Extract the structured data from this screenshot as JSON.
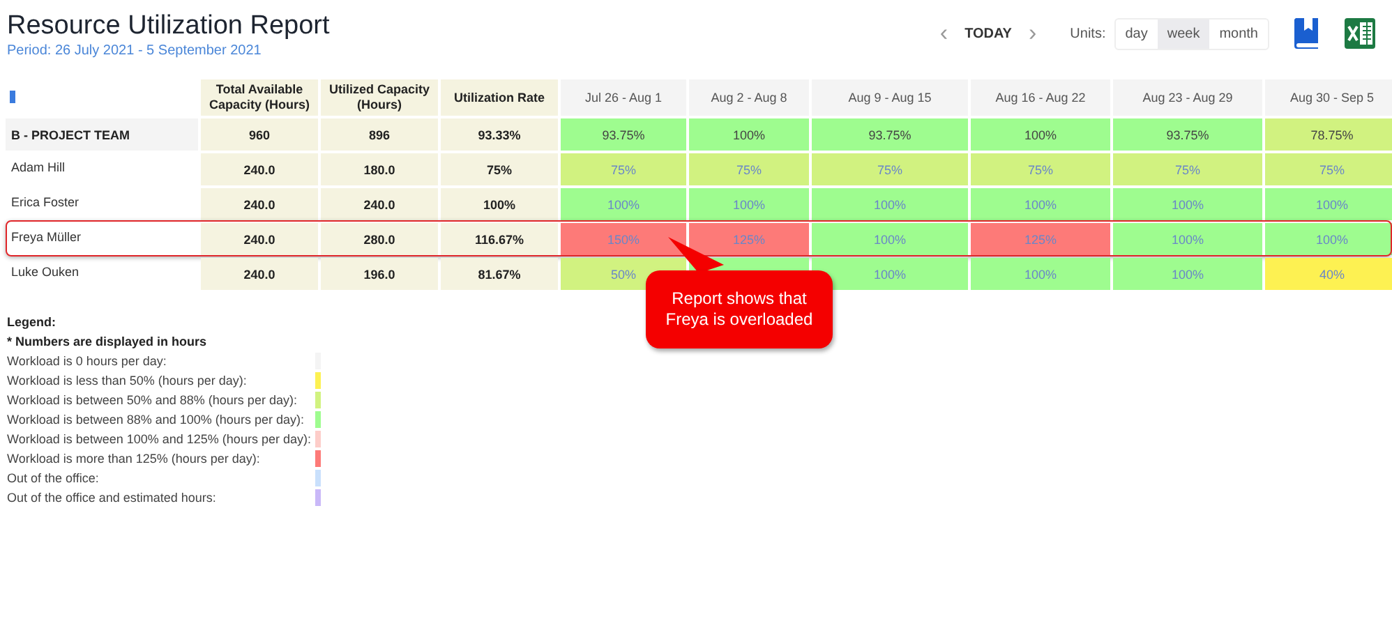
{
  "header": {
    "title": "Resource Utilization Report",
    "period": "Period: 26 July 2021 - 5 September 2021"
  },
  "navigation": {
    "prev": "‹",
    "today": "TODAY",
    "next": "›",
    "units_label": "Units:",
    "units": [
      {
        "label": "day",
        "selected": false
      },
      {
        "label": "week",
        "selected": true
      },
      {
        "label": "month",
        "selected": false
      }
    ]
  },
  "table": {
    "columns": [
      "Total Available Capacity (Hours)",
      "Utilized Capacity (Hours)",
      "Utilization Rate"
    ],
    "weeks": [
      "Jul 26 - Aug 1",
      "Aug 2 - Aug 8",
      "Aug 9 - Aug 15",
      "Aug 16 - Aug 22",
      "Aug 23 - Aug 29",
      "Aug 30 - Sep 5"
    ],
    "rows": [
      {
        "kind": "group",
        "name": "B - PROJECT TEAM",
        "total": "960",
        "utilized": "896",
        "rate": "93.33%",
        "highlighted": false,
        "cells": [
          {
            "text": "93.75%",
            "color": "#9efc8f"
          },
          {
            "text": "100%",
            "color": "#9efc8f"
          },
          {
            "text": "93.75%",
            "color": "#9efc8f"
          },
          {
            "text": "100%",
            "color": "#9efc8f"
          },
          {
            "text": "93.75%",
            "color": "#9efc8f"
          },
          {
            "text": "78.75%",
            "color": "#d1f280"
          }
        ]
      },
      {
        "kind": "person",
        "name": "Adam Hill",
        "total": "240.0",
        "utilized": "180.0",
        "rate": "75%",
        "highlighted": false,
        "cells": [
          {
            "text": "75%",
            "color": "#d1f280"
          },
          {
            "text": "75%",
            "color": "#d1f280"
          },
          {
            "text": "75%",
            "color": "#d1f280"
          },
          {
            "text": "75%",
            "color": "#d1f280"
          },
          {
            "text": "75%",
            "color": "#d1f280"
          },
          {
            "text": "75%",
            "color": "#d1f280"
          }
        ]
      },
      {
        "kind": "person",
        "name": "Erica Foster",
        "total": "240.0",
        "utilized": "240.0",
        "rate": "100%",
        "highlighted": false,
        "cells": [
          {
            "text": "100%",
            "color": "#9efc8f"
          },
          {
            "text": "100%",
            "color": "#9efc8f"
          },
          {
            "text": "100%",
            "color": "#9efc8f"
          },
          {
            "text": "100%",
            "color": "#9efc8f"
          },
          {
            "text": "100%",
            "color": "#9efc8f"
          },
          {
            "text": "100%",
            "color": "#9efc8f"
          }
        ]
      },
      {
        "kind": "person",
        "name": "Freya Müller",
        "total": "240.0",
        "utilized": "280.0",
        "rate": "116.67%",
        "highlighted": true,
        "cells": [
          {
            "text": "150%",
            "color": "#fd7a78"
          },
          {
            "text": "125%",
            "color": "#fd7a78"
          },
          {
            "text": "100%",
            "color": "#9efc8f"
          },
          {
            "text": "125%",
            "color": "#fd7a78"
          },
          {
            "text": "100%",
            "color": "#9efc8f"
          },
          {
            "text": "100%",
            "color": "#9efc8f"
          }
        ]
      },
      {
        "kind": "person",
        "name": "Luke Ouken",
        "total": "240.0",
        "utilized": "196.0",
        "rate": "81.67%",
        "highlighted": false,
        "cells": [
          {
            "text": "50%",
            "color": "#d1f280"
          },
          {
            "color": "#9efc8f"
          },
          {
            "text": "100%",
            "color": "#9efc8f"
          },
          {
            "text": "100%",
            "color": "#9efc8f"
          },
          {
            "text": "100%",
            "color": "#9efc8f"
          },
          {
            "text": "40%",
            "color": "#fdf152"
          }
        ]
      }
    ]
  },
  "callout": {
    "text": "Report shows that Freya is overloaded"
  },
  "legend": {
    "title": "Legend:",
    "note": "* Numbers are displayed in hours",
    "items": [
      {
        "label": "Workload is 0 hours per day:",
        "color": "#f4f4f4"
      },
      {
        "label": "Workload is less than 50% (hours per day):",
        "color": "#fdf152"
      },
      {
        "label": "Workload is between 50% and 88% (hours per day):",
        "color": "#d1f280"
      },
      {
        "label": "Workload is between 88% and 100% (hours per day):",
        "color": "#9efc8f"
      },
      {
        "label": "Workload is between 100% and 125% (hours per day):",
        "color": "#fdcdc9"
      },
      {
        "label": "Workload is more than 125% (hours per day):",
        "color": "#fd7a78"
      },
      {
        "label": "Out of the office:",
        "color": "#c9e0fc"
      },
      {
        "label": "Out of the office and estimated hours:",
        "color": "#c9b8f8"
      }
    ]
  }
}
